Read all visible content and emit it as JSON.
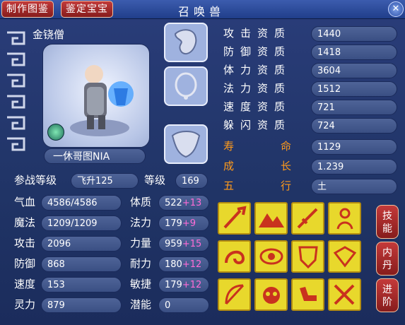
{
  "titlebar": {
    "btn_catalog": "制作图鉴",
    "btn_appraise": "鉴定宝宝",
    "title": "召唤兽"
  },
  "pet": {
    "type_name": "金铙僧",
    "nickname": "一休哥图NIA",
    "level_label": "参战等级",
    "level_value": "飞升125",
    "grade_label": "等级",
    "grade_value": "169"
  },
  "equip_slots": [
    "helmet-icon",
    "necklace-icon",
    "armor-icon"
  ],
  "aptitudes": [
    {
      "label": "攻击资质",
      "value": "1440"
    },
    {
      "label": "防御资质",
      "value": "1418"
    },
    {
      "label": "体力资质",
      "value": "3604"
    },
    {
      "label": "法力资质",
      "value": "1512"
    },
    {
      "label": "速度资质",
      "value": "721"
    },
    {
      "label": "躲闪资质",
      "value": "724"
    }
  ],
  "special": [
    {
      "label": "寿命",
      "value": "1129"
    },
    {
      "label": "成长",
      "value": "1.239"
    },
    {
      "label": "五行",
      "value": "土"
    }
  ],
  "left_stats": [
    {
      "label": "气血",
      "value": "4586/4586"
    },
    {
      "label": "魔法",
      "value": "1209/1209"
    },
    {
      "label": "攻击",
      "value": "2096"
    },
    {
      "label": "防御",
      "value": "868"
    },
    {
      "label": "速度",
      "value": "153"
    },
    {
      "label": "灵力",
      "value": "879"
    }
  ],
  "mid_stats": [
    {
      "label": "体质",
      "value": "522",
      "plus": "+13"
    },
    {
      "label": "法力",
      "value": "179",
      "plus": "+9"
    },
    {
      "label": "力量",
      "value": "959",
      "plus": "+15"
    },
    {
      "label": "耐力",
      "value": "180",
      "plus": "+12"
    },
    {
      "label": "敏捷",
      "value": "179",
      "plus": "+12"
    },
    {
      "label": "潜能",
      "value": "0",
      "plus": ""
    }
  ],
  "skills": [
    "sword-strike-icon",
    "mountain-icon",
    "sword-icon",
    "figure-icon",
    "swirl-icon",
    "eye-icon",
    "shield-icon",
    "gem-icon",
    "bow-icon",
    "owl-icon",
    "arm-icon",
    "crossed-swords-icon"
  ],
  "side_buttons": [
    "技能",
    "内丹",
    "进阶"
  ]
}
